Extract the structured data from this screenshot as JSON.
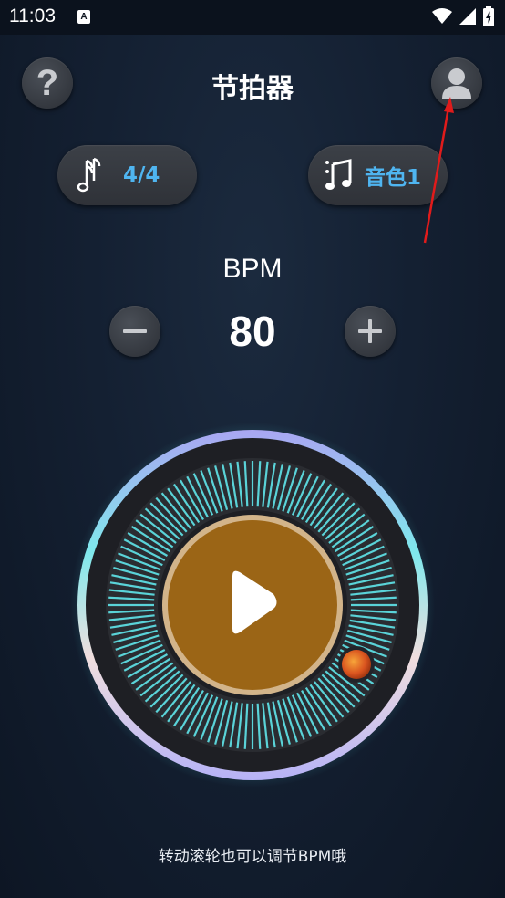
{
  "status_bar": {
    "time": "11:03",
    "notification_icon_letter": "A",
    "icons": [
      "wifi-icon",
      "signal-icon",
      "battery-charging-icon"
    ]
  },
  "header": {
    "title": "节拍器",
    "help_icon": "question-mark-icon",
    "profile_icon": "user-icon"
  },
  "controls": {
    "time_signature": {
      "icon": "music-note-icon",
      "label": "4/4"
    },
    "sound": {
      "icon": "music-notes-icon",
      "label": "音色1"
    }
  },
  "bpm": {
    "label": "BPM",
    "value": "80",
    "minus_icon": "minus-icon",
    "plus_icon": "plus-icon"
  },
  "dial": {
    "play_icon": "play-icon",
    "knob": "rotation-knob"
  },
  "hint": "转动滚轮也可以调节BPM哦",
  "colors": {
    "accent_blue": "#4fb5f0",
    "center_gold": "#9b6516",
    "tick_cyan": "#5ad3d8",
    "annotation_red": "#e01b1b"
  }
}
